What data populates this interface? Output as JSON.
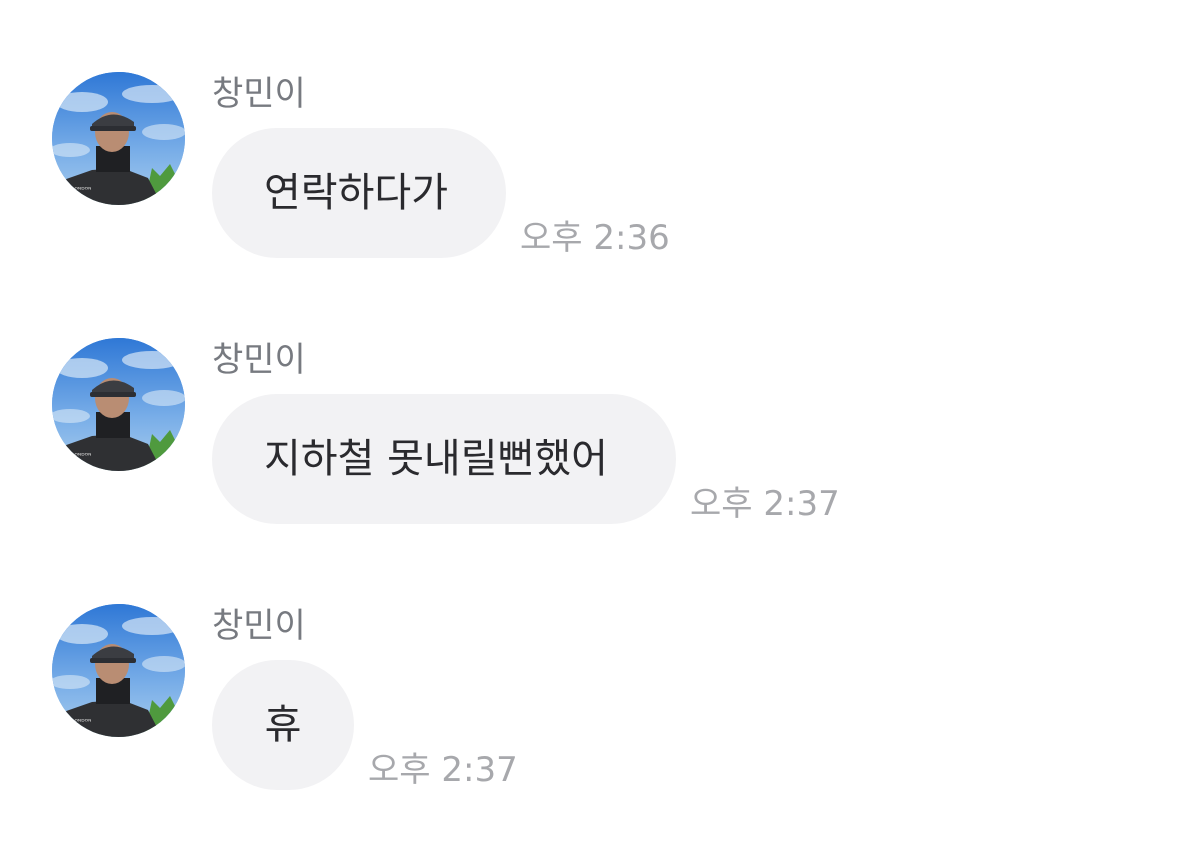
{
  "messages": [
    {
      "sender": "창민이",
      "text": "연락하다가",
      "time": "오후 2:36",
      "avatar_icon": "profile-photo"
    },
    {
      "sender": "창민이",
      "text": "지하철 못내릴뻔했어",
      "time": "오후 2:37",
      "avatar_icon": "profile-photo"
    },
    {
      "sender": "창민이",
      "text": "휴",
      "time": "오후 2:37",
      "avatar_icon": "profile-photo"
    }
  ],
  "colors": {
    "background": "#ffffff",
    "bubble": "#f2f2f4",
    "message_text": "#2a2a2e",
    "sender_name": "#777a80",
    "timestamp": "#a7a8ac"
  }
}
